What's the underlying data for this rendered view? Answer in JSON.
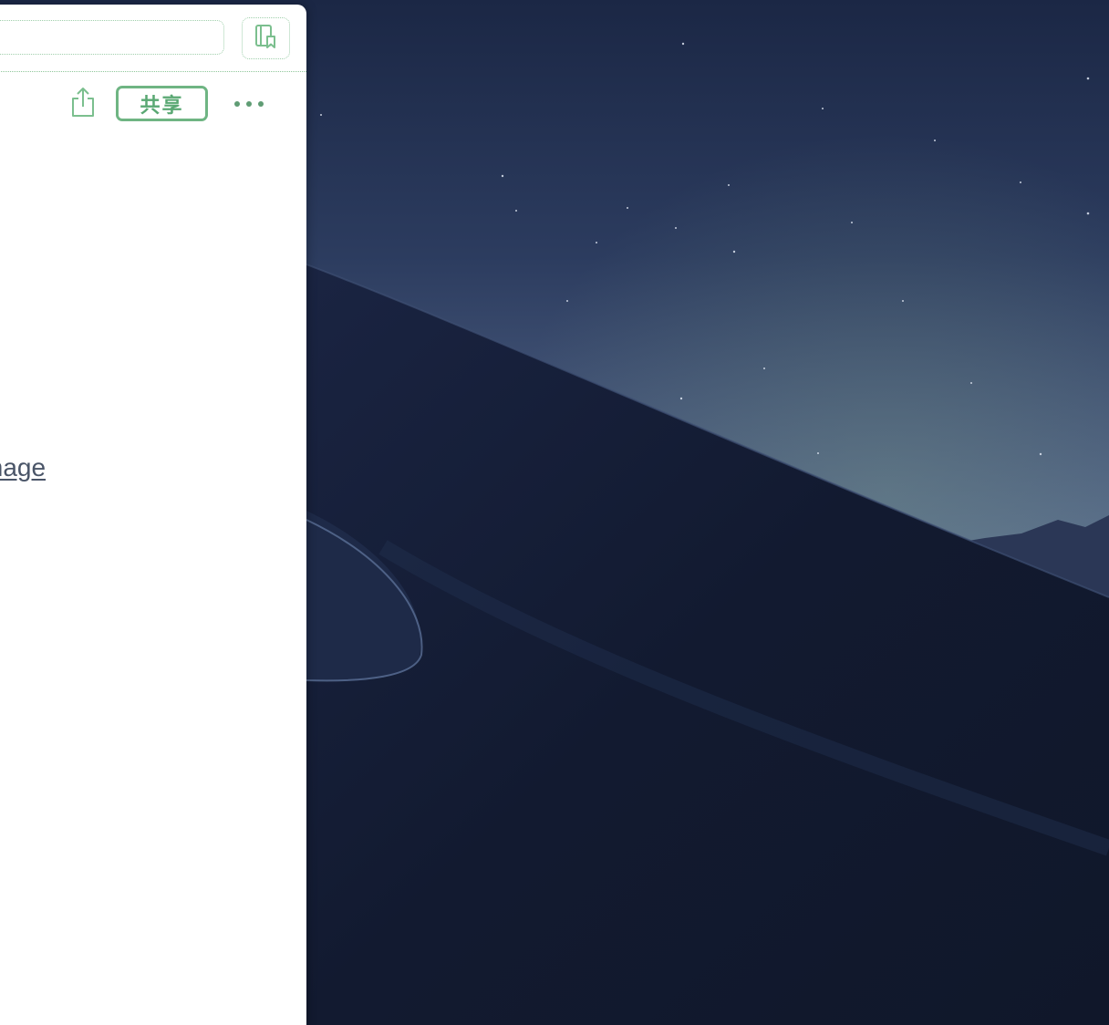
{
  "window": {
    "address_bar": {
      "value": ""
    },
    "reading_list_icon": "reading-list-icon",
    "page_toolbar": {
      "share_icon": "share-icon",
      "share_label": "共享",
      "more_icon": "more-icon"
    },
    "content": {
      "link_text": "mage"
    }
  },
  "desktop": {
    "wallpaper": "night-desert-dunes"
  },
  "colors": {
    "accent_green": "#6fb583",
    "link_gray": "#4a5568",
    "sky_top": "#1d2a4a",
    "sky_horizon": "#566a8c",
    "dune_dark": "#121a30"
  }
}
